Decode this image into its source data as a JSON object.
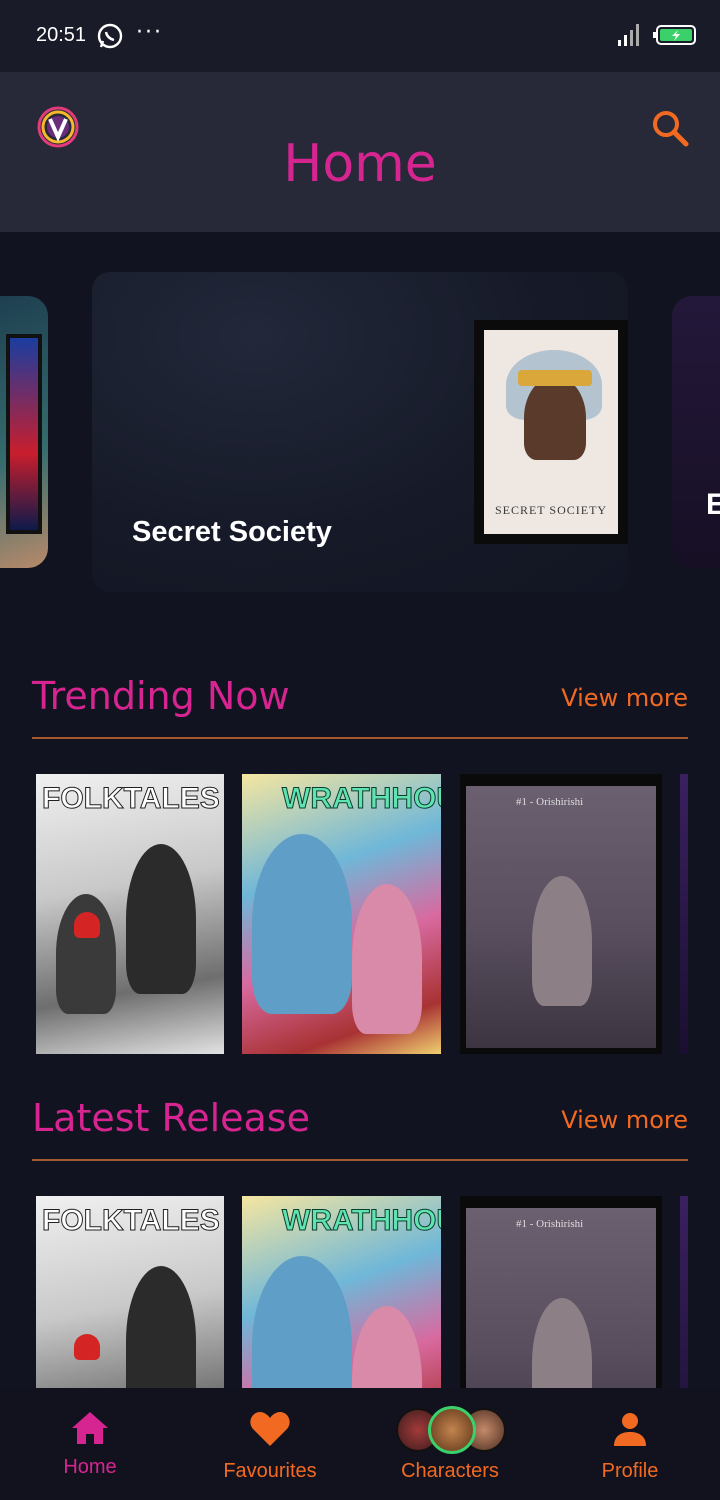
{
  "status_bar": {
    "time": "20:51",
    "dots": "···"
  },
  "header": {
    "title": "Home",
    "search_icon": "search-icon",
    "logo_icon": "vortex-logo-icon"
  },
  "carousel": {
    "featured_title": "Secret Society",
    "featured_cover_text": "SECRET SOCIETY",
    "next_card_initial": "E"
  },
  "sections": [
    {
      "title": "Trending Now",
      "view_more": "View more"
    },
    {
      "title": "Latest Release",
      "view_more": "View more"
    }
  ],
  "covers": [
    {
      "logo": "FOLKTALES"
    },
    {
      "logo": "WRATHHOUSE"
    },
    {
      "title": "#1 - Orishirishi"
    }
  ],
  "bottom_nav": [
    {
      "label": "Home",
      "icon": "home-icon"
    },
    {
      "label": "Favourites",
      "icon": "heart-icon"
    },
    {
      "label": "Characters",
      "icon": "characters-avatars-icon"
    },
    {
      "label": "Profile",
      "icon": "person-icon"
    }
  ],
  "colors": {
    "accent_pink": "#d62491",
    "accent_orange": "#f26a22",
    "background": "#121320"
  }
}
